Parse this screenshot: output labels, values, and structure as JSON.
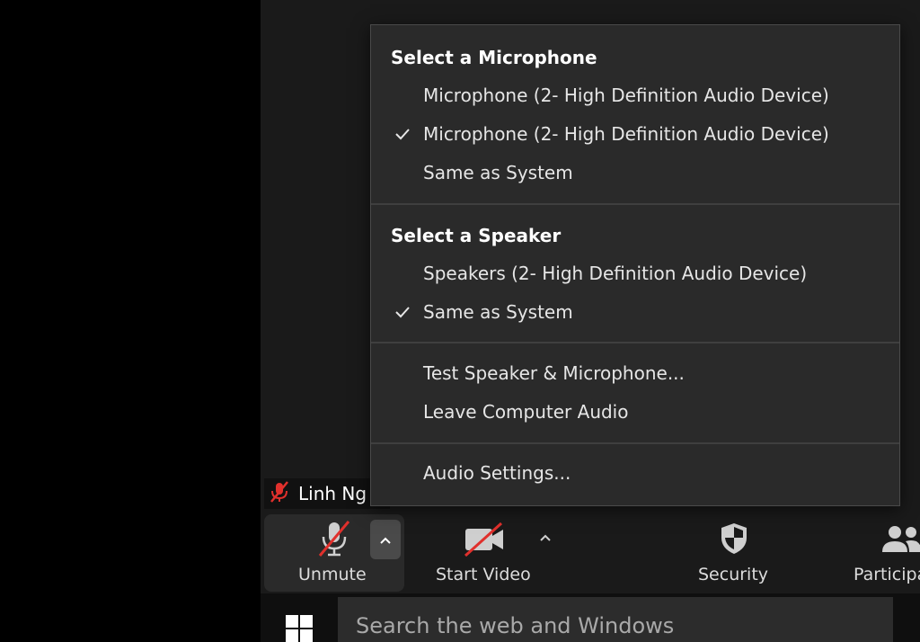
{
  "participant": {
    "name": "Linh Ng"
  },
  "toolbar": {
    "unmute_label": "Unmute",
    "start_video_label": "Start Video",
    "security_label": "Security",
    "participants_label": "Participa"
  },
  "audio_menu": {
    "microphone_heading": "Select a Microphone",
    "microphones": [
      {
        "label": "Microphone (2- High Definition Audio Device)",
        "checked": false
      },
      {
        "label": "Microphone (2- High Definition Audio Device)",
        "checked": true
      },
      {
        "label": "Same as System",
        "checked": false
      }
    ],
    "speaker_heading": "Select a Speaker",
    "speakers": [
      {
        "label": "Speakers (2- High Definition Audio Device)",
        "checked": false
      },
      {
        "label": "Same as System",
        "checked": true
      }
    ],
    "test_label": "Test Speaker & Microphone...",
    "leave_label": "Leave Computer Audio",
    "settings_label": "Audio Settings..."
  },
  "taskbar": {
    "search_placeholder": "Search the web and Windows"
  },
  "colors": {
    "mute_red": "#e0302c",
    "menu_bg": "#2a2a2a",
    "toolbar_bg": "#1a1a1a"
  }
}
